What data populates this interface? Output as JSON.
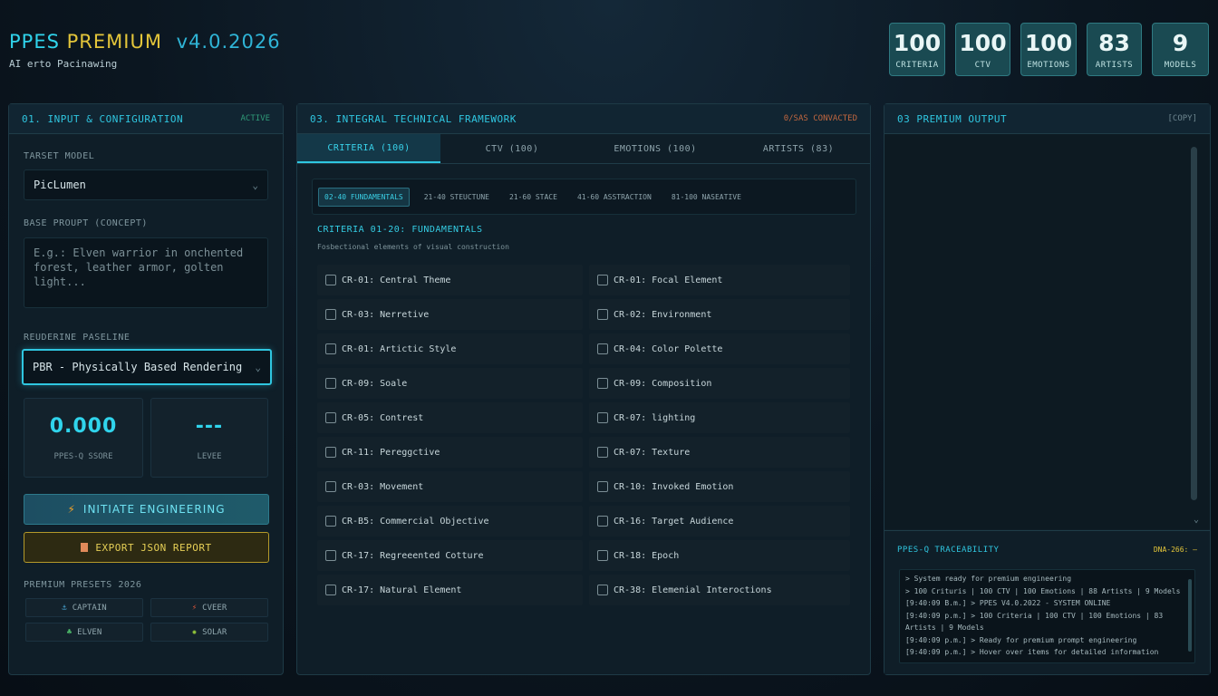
{
  "brand": {
    "title_part1": "PPES",
    "title_part2": "PREMIUM",
    "version": "v4.0.2026",
    "subtitle": "AI erto Pacinawing"
  },
  "stats": [
    {
      "value": "100",
      "label": "CRITERIA"
    },
    {
      "value": "100",
      "label": "CTV"
    },
    {
      "value": "100",
      "label": "EMOTIONS"
    },
    {
      "value": "83",
      "label": "ARTISTS"
    },
    {
      "value": "9",
      "label": "MODELS"
    }
  ],
  "input_panel": {
    "title": "01. INPUT & CONFIGURATION",
    "status": "ACTIVE",
    "target_model_label": "TARSET MODEL",
    "target_model_value": "PicLumen",
    "base_prompt_label": "BASE PROUPT (CONCEPT)",
    "base_prompt_placeholder": "E.g.: Elven warrior in onchented forest, leather armor, golten light...",
    "pipeline_label": "REUDERINE PASELINE",
    "pipeline_value": "PBR - Physically Based Rendering",
    "score_value": "0.000",
    "score_label": "PPES-Q SSORE",
    "level_value": "---",
    "level_label": "LEVEE",
    "initiate_label": "INITIATE ENGINEERING",
    "export_label": "EXPORT JSON REPORT",
    "presets_label": "PREMIUM PRESETS 2026",
    "presets": [
      {
        "label": "CAPTAIN",
        "icon": "anchor-icon",
        "color": "#4aa8d8"
      },
      {
        "label": "CVEER",
        "icon": "bolt-icon",
        "color": "#e0563a"
      },
      {
        "label": "ELVEN",
        "icon": "leaf-icon",
        "color": "#4dbb6a"
      },
      {
        "label": "SOLAR",
        "icon": "sun-icon",
        "color": "#8fc23a"
      }
    ]
  },
  "framework_panel": {
    "title": "03. INTEGRAL TECHNICAL FRAMEWORK",
    "status": "0/SAS CONVACTED",
    "tabs": [
      "CRITERIA (100)",
      "CTV (100)",
      "EMOTIONS (100)",
      "ARTISTS (83)"
    ],
    "subtabs": [
      "02-40 FUNDAMENTALS",
      "21-40 STEUCTUNE",
      "21-60 STACE",
      "41-60 ASSTRACTION",
      "81-100 NASEATIVE"
    ],
    "section_title": "CRITERIA 01-20: FUNDAMENTALS",
    "section_subtitle": "Fosbectional elements of visual construction",
    "criteria": [
      "CR-01: Central Theme",
      "CR-01: Focal Element",
      "CR-03: Nerretive",
      "CR-02: Environment",
      "CR-01: Artictic Style",
      "CR-04: Color Polette",
      "CR-09: Soale",
      "CR-09: Composition",
      "CR-05: Contrest",
      "CR-07: lighting",
      "CR-11: Pereggctive",
      "CR-07: Texture",
      "CR-03: Movement",
      "CR-10: Invoked Emotion",
      "CR-B5: Commercial Objective",
      "CR-16: Target Audience",
      "CR-17: Regreeented Cotture",
      "CR-18: Epoch",
      "CR-17: Natural Element",
      "CR-38: Elemenial Interoctions"
    ]
  },
  "output_panel": {
    "title": "03 PREMIUM OUTPUT",
    "copy_label": "[COPY]",
    "trace_title": "PPES-Q TRACEABILITY",
    "trace_tag": "DNA-266: —",
    "log": [
      "> System ready for premium engineering",
      "> 100 Crituris | 100 CTV | 100 Emotions | 88 Artists | 9 Models",
      "[9:40:09 B.m.] > PPES V4.0.2022 - SYSTEM ONLINE",
      "[9:40:09 p.m.] > 100 Criteria | 100 CTV | 100 Emotions | 83 Artists | 9 Models",
      "[9:40:09 p.m.] > Ready for premium prompt engineering",
      "[9:40:09 p.m.] > Hover over items for detailed information"
    ]
  }
}
